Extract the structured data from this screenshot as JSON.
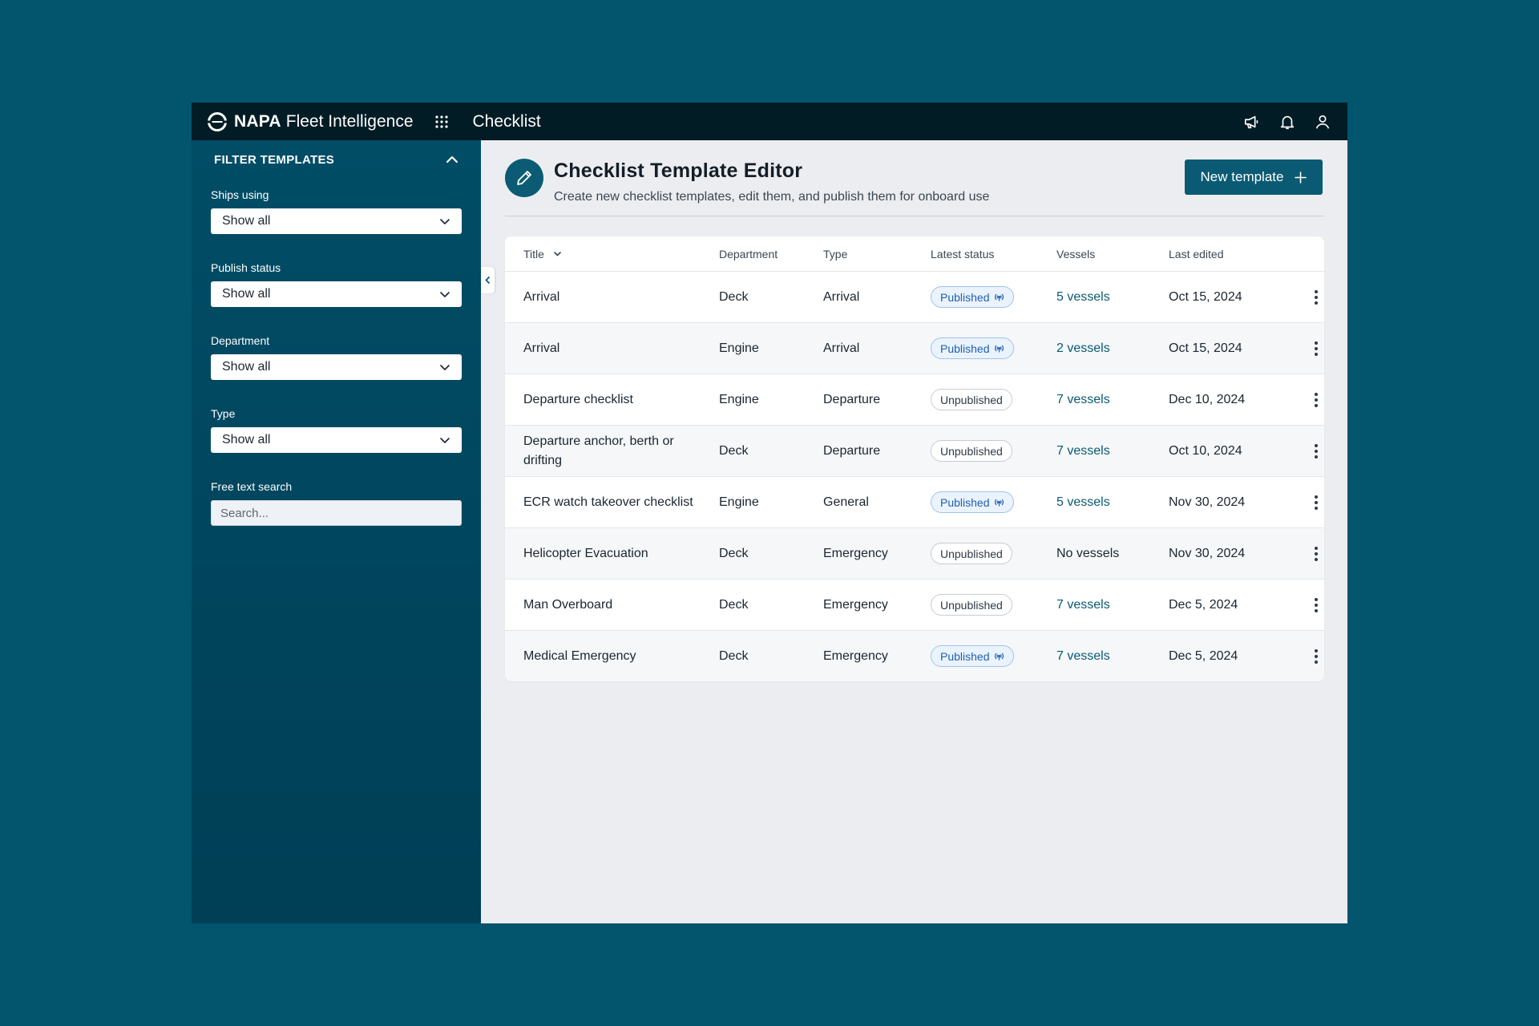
{
  "app": {
    "brand_bold": "NAPA",
    "brand_light": "Fleet Intelligence",
    "title": "Checklist"
  },
  "sidebar": {
    "heading": "FILTER TEMPLATES",
    "filters": [
      {
        "label": "Ships using",
        "value": "Show all"
      },
      {
        "label": "Publish status",
        "value": "Show all"
      },
      {
        "label": "Department",
        "value": "Show all"
      },
      {
        "label": "Type",
        "value": "Show all"
      }
    ],
    "search": {
      "label": "Free text search",
      "placeholder": "Search..."
    }
  },
  "page": {
    "title": "Checklist Template Editor",
    "subtitle": "Create new checklist templates, edit them, and publish them for onboard use",
    "new_button": "New template"
  },
  "table": {
    "columns": [
      "Title",
      "Department",
      "Type",
      "Latest status",
      "Vessels",
      "Last edited"
    ],
    "rows": [
      {
        "title": "Arrival",
        "department": "Deck",
        "type": "Arrival",
        "status": "Published",
        "published": true,
        "vessels": "5 vessels",
        "edited": "Oct 15, 2024"
      },
      {
        "title": "Arrival",
        "department": "Engine",
        "type": "Arrival",
        "status": "Published",
        "published": true,
        "vessels": "2 vessels",
        "edited": "Oct 15, 2024"
      },
      {
        "title": "Departure checklist",
        "department": "Engine",
        "type": "Departure",
        "status": "Unpublished",
        "published": false,
        "vessels": "7 vessels",
        "edited": "Dec 10, 2024"
      },
      {
        "title": "Departure anchor, berth or drifting",
        "department": "Deck",
        "type": "Departure",
        "status": "Unpublished",
        "published": false,
        "vessels": "7 vessels",
        "edited": "Oct 10, 2024"
      },
      {
        "title": "ECR watch takeover checklist",
        "department": "Engine",
        "type": "General",
        "status": "Published",
        "published": true,
        "vessels": "5 vessels",
        "edited": "Nov 30, 2024"
      },
      {
        "title": "Helicopter Evacuation",
        "department": "Deck",
        "type": "Emergency",
        "status": "Unpublished",
        "published": false,
        "vessels": "No vessels",
        "edited": "Nov 30, 2024"
      },
      {
        "title": "Man Overboard",
        "department": "Deck",
        "type": "Emergency",
        "status": "Unpublished",
        "published": false,
        "vessels": "7 vessels",
        "edited": "Dec 5, 2024"
      },
      {
        "title": "Medical Emergency",
        "department": "Deck",
        "type": "Emergency",
        "status": "Published",
        "published": true,
        "vessels": "7 vessels",
        "edited": "Dec 5, 2024"
      }
    ]
  },
  "colors": {
    "background": "#03546d",
    "topbar": "#021c26",
    "sidebar": "#014d66",
    "accent": "#0a5a73",
    "published": "#1e5fb0"
  },
  "icons": {
    "logo": "napa-logo-icon",
    "apps": "apps-grid-icon",
    "announcements": "megaphone-icon",
    "notifications": "bell-icon",
    "account": "user-icon",
    "collapse": "chevron-up-icon",
    "dropdown": "chevron-down-icon",
    "edit": "pencil-icon",
    "add": "plus-icon",
    "published": "broadcast-icon",
    "menu": "kebab-icon"
  }
}
